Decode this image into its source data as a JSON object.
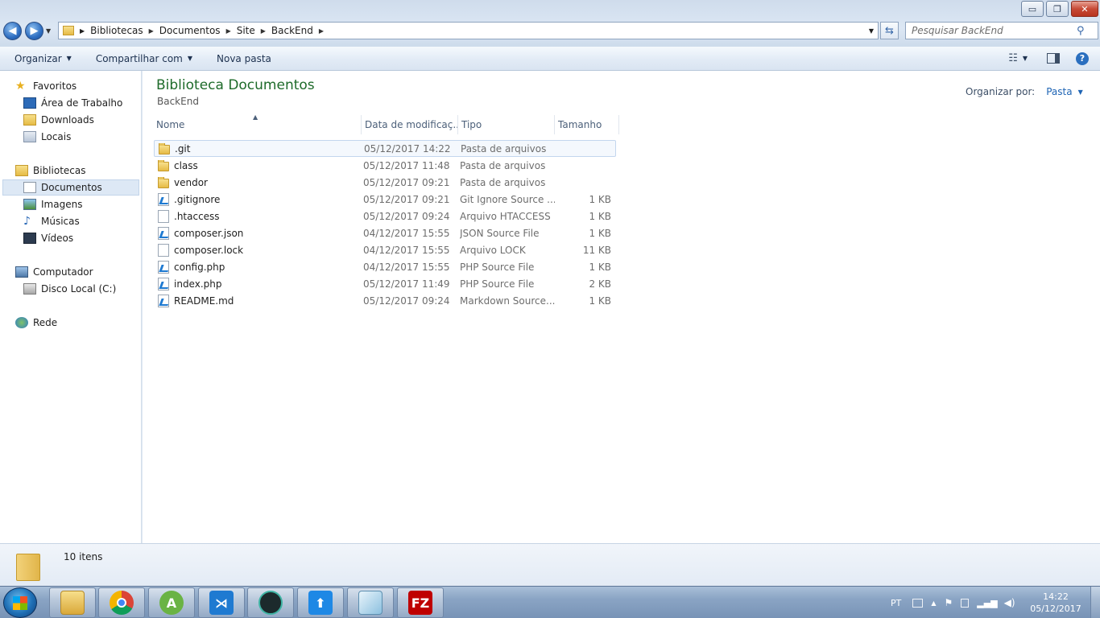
{
  "window": {
    "controls": {
      "minimize": "▭",
      "maximize": "❐",
      "close": "✕"
    }
  },
  "address": {
    "breadcrumbs": [
      "Bibliotecas",
      "Documentos",
      "Site",
      "BackEnd"
    ],
    "search_placeholder": "Pesquisar BackEnd"
  },
  "toolbar": {
    "organize_label": "Organizar",
    "share_label": "Compartilhar com",
    "new_folder_label": "Nova pasta"
  },
  "sidebar": {
    "favorites": {
      "label": "Favoritos",
      "items": [
        "Área de Trabalho",
        "Downloads",
        "Locais"
      ]
    },
    "libraries": {
      "label": "Bibliotecas",
      "items": [
        "Documentos",
        "Imagens",
        "Músicas",
        "Vídeos"
      ]
    },
    "computer": {
      "label": "Computador",
      "items": [
        "Disco Local (C:)"
      ]
    },
    "network": {
      "label": "Rede"
    }
  },
  "main": {
    "library_title": "Biblioteca Documentos",
    "library_subtitle": "BackEnd",
    "arrange_label": "Organizar por:",
    "arrange_value": "Pasta",
    "columns": [
      "Nome",
      "Data de modificaç...",
      "Tipo",
      "Tamanho"
    ],
    "files": [
      {
        "name": ".git",
        "date": "05/12/2017 14:22",
        "type": "Pasta de arquivos",
        "size": "",
        "icon": "folder-icon"
      },
      {
        "name": "class",
        "date": "05/12/2017 11:48",
        "type": "Pasta de arquivos",
        "size": "",
        "icon": "folder-icon"
      },
      {
        "name": "vendor",
        "date": "05/12/2017 09:21",
        "type": "Pasta de arquivos",
        "size": "",
        "icon": "folder-icon"
      },
      {
        "name": ".gitignore",
        "date": "05/12/2017 09:21",
        "type": "Git Ignore Source ...",
        "size": "1 KB",
        "icon": "vscode-file-icon"
      },
      {
        "name": ".htaccess",
        "date": "05/12/2017 09:24",
        "type": "Arquivo HTACCESS",
        "size": "1 KB",
        "icon": "blank-file-icon"
      },
      {
        "name": "composer.json",
        "date": "04/12/2017 15:55",
        "type": "JSON Source File",
        "size": "1 KB",
        "icon": "vscode-file-icon"
      },
      {
        "name": "composer.lock",
        "date": "04/12/2017 15:55",
        "type": "Arquivo LOCK",
        "size": "11 KB",
        "icon": "blank-file-icon"
      },
      {
        "name": "config.php",
        "date": "04/12/2017 15:55",
        "type": "PHP Source File",
        "size": "1 KB",
        "icon": "vscode-file-icon"
      },
      {
        "name": "index.php",
        "date": "05/12/2017 11:49",
        "type": "PHP Source File",
        "size": "2 KB",
        "icon": "vscode-file-icon"
      },
      {
        "name": "README.md",
        "date": "05/12/2017 09:24",
        "type": "Markdown Source...",
        "size": "1 KB",
        "icon": "vscode-file-icon"
      }
    ]
  },
  "details": {
    "count": "10 itens"
  },
  "taskbar": {
    "apps": [
      "explorer-icon",
      "chrome-icon",
      "android-studio-icon",
      "vscode-icon",
      "gitkraken-icon",
      "upload-icon",
      "notepad-icon",
      "filezilla-icon"
    ],
    "language": "PT",
    "time": "14:22",
    "date": "05/12/2017"
  },
  "colors": {
    "library_title": "#1e6b2a",
    "link": "#1e64b4",
    "selection": "#c3d6ee"
  }
}
